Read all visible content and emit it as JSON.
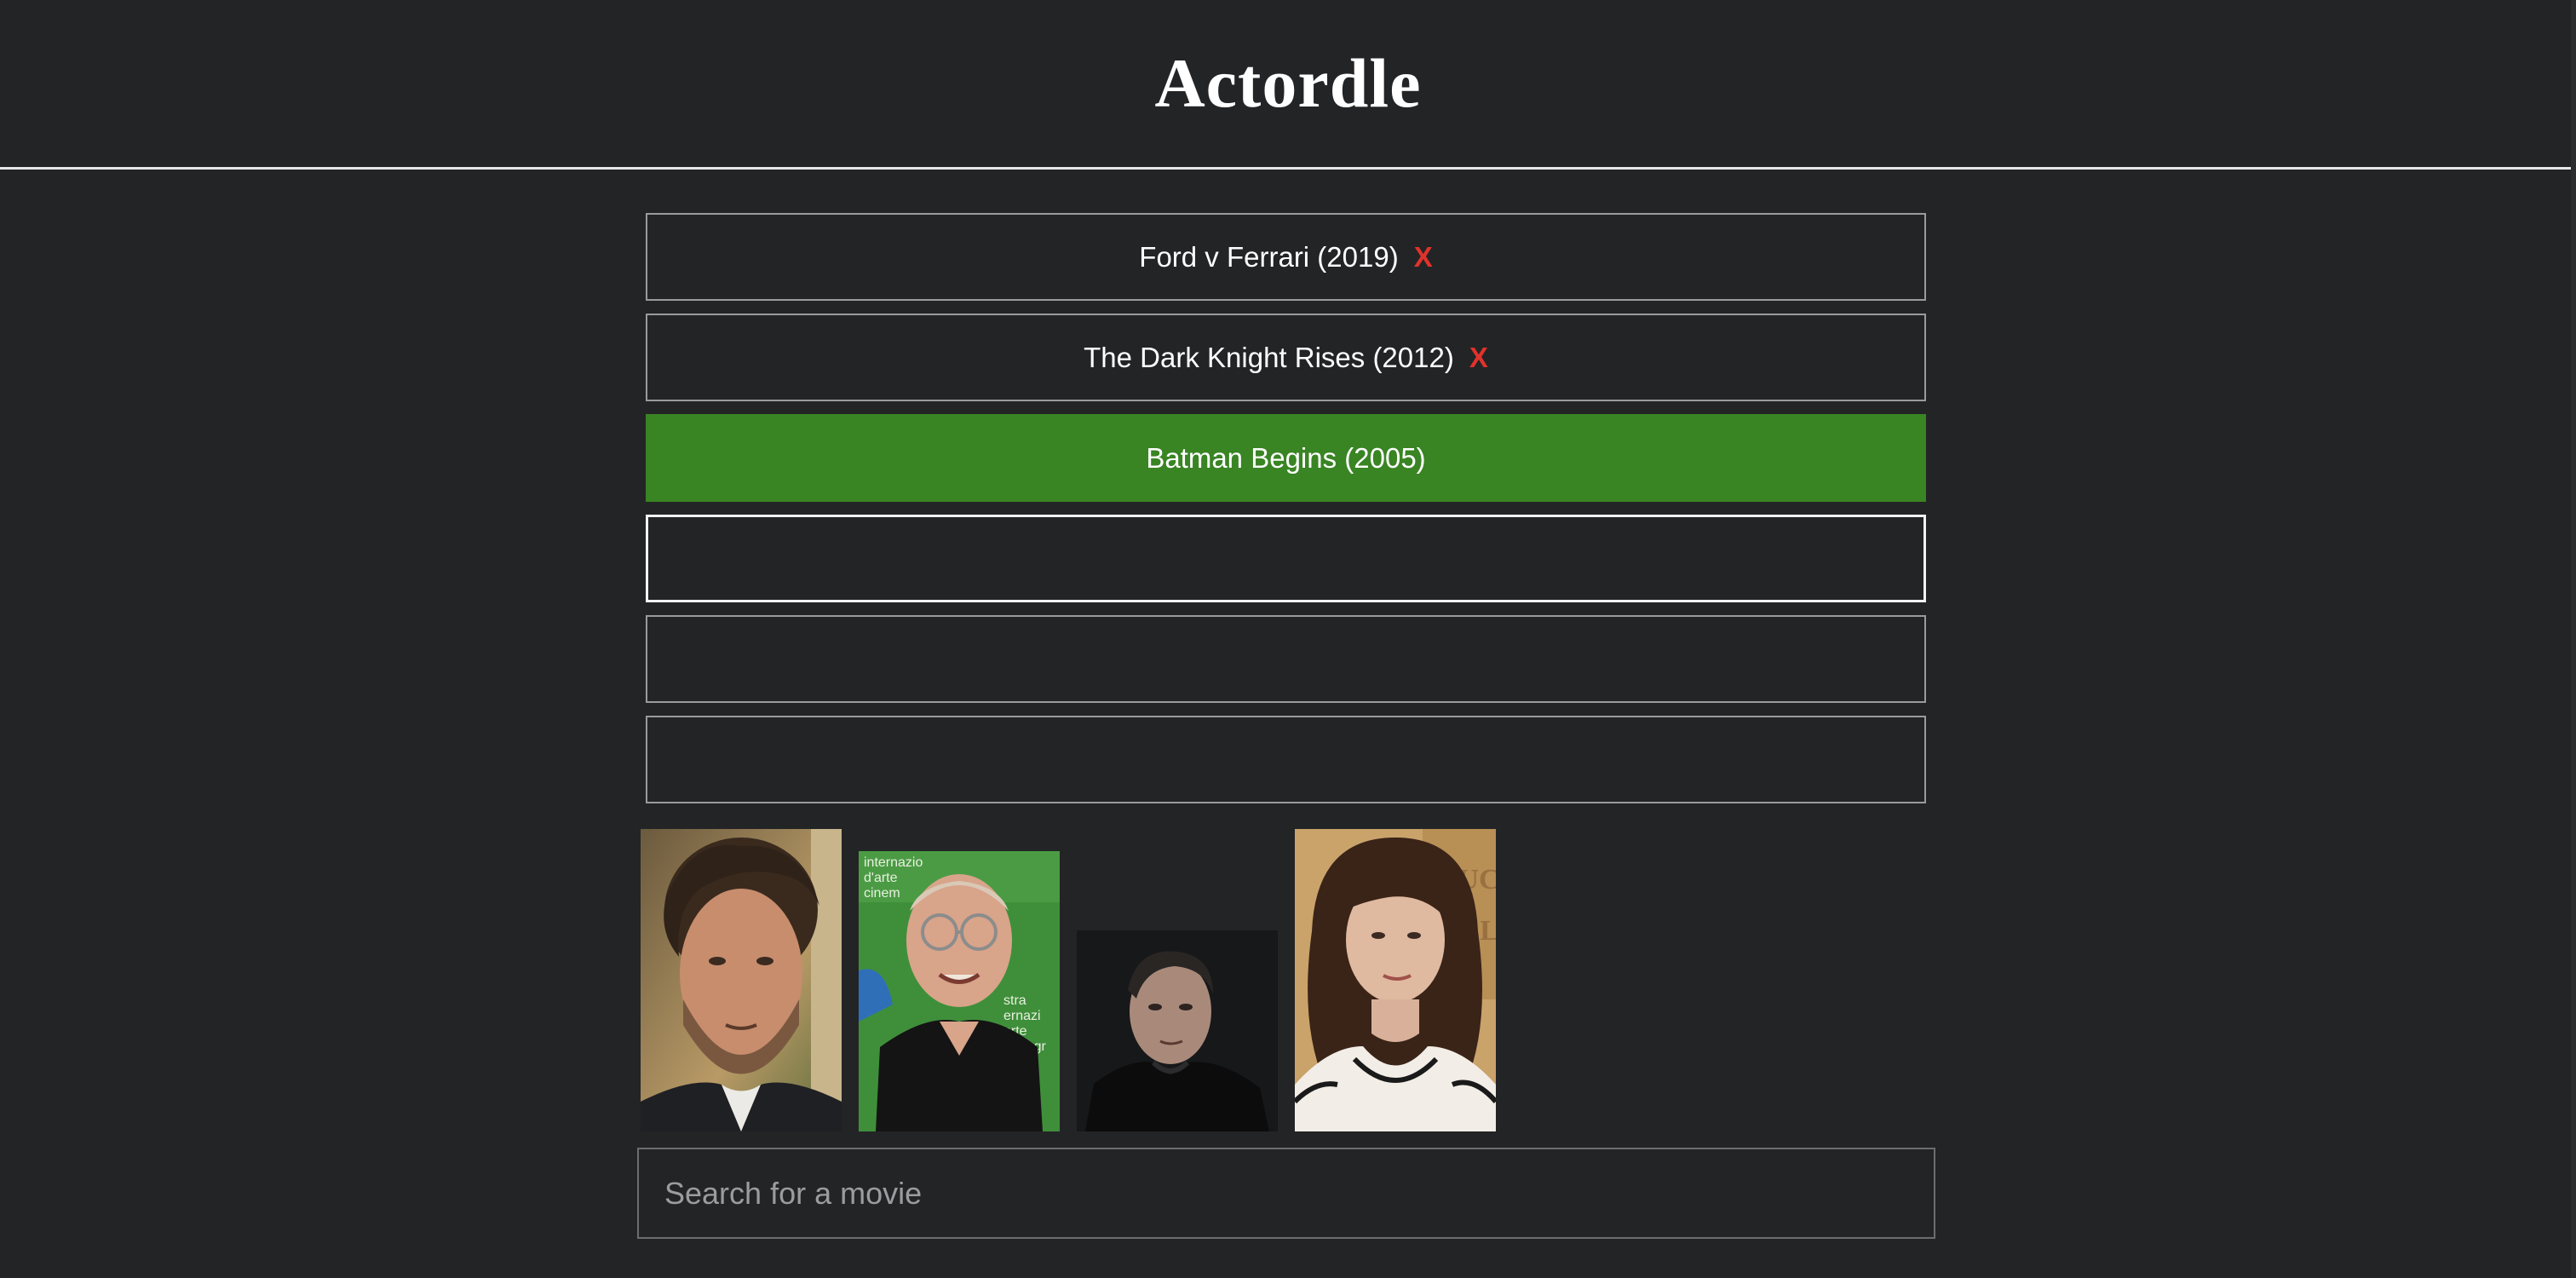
{
  "app": {
    "title": "Actordle"
  },
  "guesses": [
    {
      "label": "Ford v Ferrari (2019)",
      "mark": "X",
      "status": "wrong"
    },
    {
      "label": "The Dark Knight Rises (2012)",
      "mark": "X",
      "status": "wrong"
    },
    {
      "label": "Batman Begins (2005)",
      "mark": "",
      "status": "correct"
    },
    {
      "label": "",
      "mark": "",
      "status": "empty-active"
    },
    {
      "label": "",
      "mark": "",
      "status": "empty"
    },
    {
      "label": "",
      "mark": "",
      "status": "empty"
    }
  ],
  "actors": [
    {
      "name": "actor-photo-1"
    },
    {
      "name": "actor-photo-2"
    },
    {
      "name": "actor-photo-3"
    },
    {
      "name": "actor-photo-4"
    }
  ],
  "search": {
    "placeholder": "Search for a movie",
    "value": ""
  },
  "colors": {
    "background": "#232426",
    "correct": "#398423",
    "wrong_mark": "#e0332b",
    "border": "#9a9b9d"
  }
}
